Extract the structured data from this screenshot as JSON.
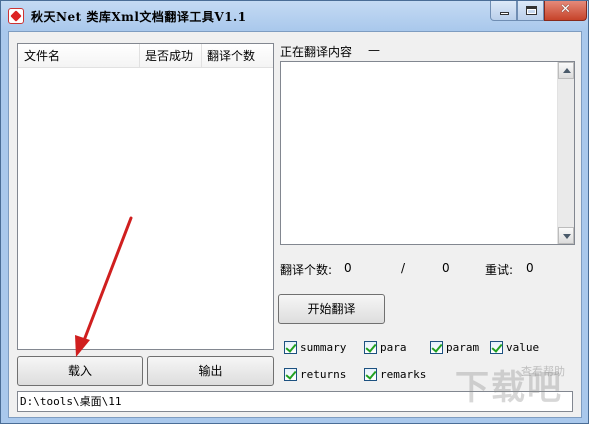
{
  "window": {
    "title": "秋天Net 类库Xml文档翻译工具V1.1",
    "minimize_label": "",
    "maximize_label": "",
    "close_label": "✕"
  },
  "file_list": {
    "columns": [
      "文件名",
      "是否成功",
      "翻译个数"
    ],
    "rows": []
  },
  "buttons": {
    "load": "载入",
    "export": "输出",
    "start": "开始翻译"
  },
  "path": "D:\\tools\\桌面\\11",
  "translating": {
    "label": "正在翻译内容",
    "value": "—"
  },
  "stats": {
    "count_label": "翻译个数:",
    "translated": "0",
    "separator": "/",
    "total": "0",
    "retry_label": "重试:",
    "retry": "0"
  },
  "options": [
    {
      "label": "summary",
      "checked": true
    },
    {
      "label": "para",
      "checked": true
    },
    {
      "label": "param",
      "checked": true
    },
    {
      "label": "value",
      "checked": true
    },
    {
      "label": "returns",
      "checked": true
    },
    {
      "label": "remarks",
      "checked": true
    }
  ],
  "watermark": {
    "text": "下载吧",
    "sub": "查看帮助"
  },
  "colors": {
    "frame": "#a9c8ec",
    "annotation_arrow": "#d01f1f",
    "checkmark": "#21a121"
  }
}
